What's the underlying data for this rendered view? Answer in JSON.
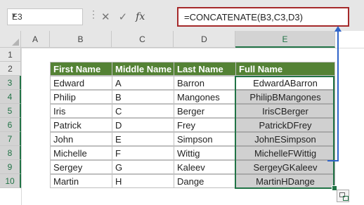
{
  "name_box": {
    "value": "E3"
  },
  "formula_bar": {
    "cancel_icon": "close-icon",
    "enter_icon": "check-icon",
    "fx_label": "fx",
    "formula": "=CONCATENATE(B3,C3,D3)"
  },
  "columns": [
    "A",
    "B",
    "C",
    "D",
    "E"
  ],
  "rows": [
    "1",
    "2",
    "3",
    "4",
    "5",
    "6",
    "7",
    "8",
    "9",
    "10"
  ],
  "table": {
    "headers": [
      "First Name",
      "Middle Name",
      "Last Name",
      "Full Name"
    ],
    "rows": [
      [
        "Edward",
        "A",
        "Barron",
        "EdwardABarron"
      ],
      [
        "Philip",
        "B",
        "Mangones",
        "PhilipBMangones"
      ],
      [
        "Iris",
        "C",
        "Berger",
        "IrisCBerger"
      ],
      [
        "Patrick",
        "D",
        "Frey",
        "PatrickDFrey"
      ],
      [
        "John",
        "E",
        "Simpson",
        "JohnESimpson"
      ],
      [
        "Michelle",
        "F",
        "Wittig",
        "MichelleFWittig"
      ],
      [
        "Sergey",
        "G",
        "Kaleev",
        "SergeyGKaleev"
      ],
      [
        "Martin",
        "H",
        "Dange",
        "MartinHDange"
      ]
    ]
  },
  "colors": {
    "header_green": "#548235",
    "selection_green": "#217346",
    "formula_border": "#a5292a",
    "arrow_blue": "#2f64c8"
  }
}
